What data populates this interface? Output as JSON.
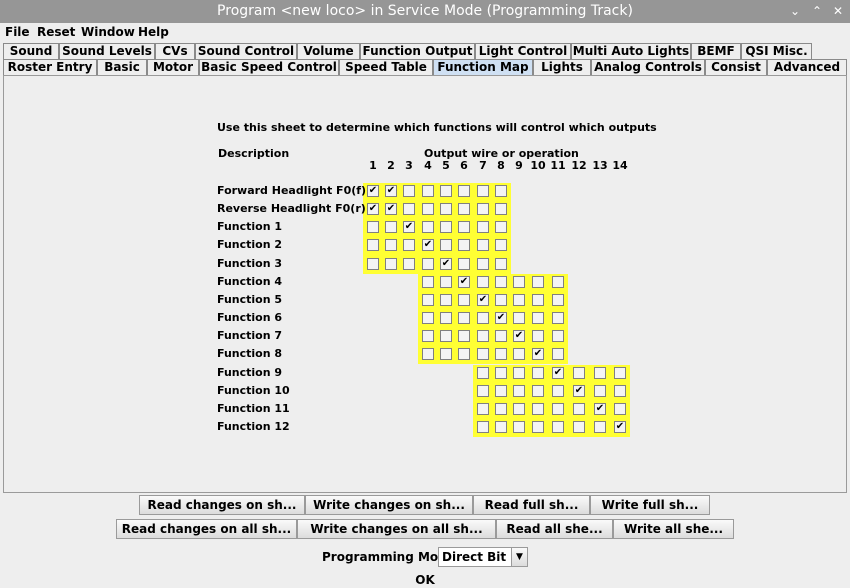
{
  "window": {
    "title": "Program <new loco> in Service Mode (Programming Track)",
    "minimize_glyph": "⌄",
    "maximize_glyph": "⌃",
    "close_glyph": "✕"
  },
  "menu": [
    "File",
    "Reset",
    "Window",
    "Help"
  ],
  "tabs_row1": [
    "Sound",
    "Sound Levels",
    "CVs",
    "Sound Control",
    "Volume",
    "Function Output",
    "Light Control",
    "Multi Auto Lights",
    "BEMF",
    "QSI Misc."
  ],
  "tabs_row2": [
    "Roster Entry",
    "Basic",
    "Motor",
    "Basic Speed Control",
    "Speed Table",
    "Function Map",
    "Lights",
    "Analog Controls",
    "Consist",
    "Advanced"
  ],
  "selected_tab": "Function Map",
  "function_map": {
    "intro": "Use this sheet to determine which functions will control which outputs",
    "description_header": "Description",
    "output_header": "Output wire or operation",
    "outputs": [
      "1",
      "2",
      "3",
      "4",
      "5",
      "6",
      "7",
      "8",
      "9",
      "10",
      "11",
      "12",
      "13",
      "14"
    ],
    "check_glyph": "✔",
    "rows": [
      {
        "label": "Forward Headlight F0(f)",
        "start": 0,
        "end": 7,
        "checked": [
          0,
          1
        ]
      },
      {
        "label": "Reverse Headlight F0(r)",
        "start": 0,
        "end": 7,
        "checked": [
          0,
          1
        ]
      },
      {
        "label": "Function 1",
        "start": 0,
        "end": 7,
        "checked": [
          2
        ]
      },
      {
        "label": "Function 2",
        "start": 0,
        "end": 7,
        "checked": [
          3
        ]
      },
      {
        "label": "Function 3",
        "start": 0,
        "end": 7,
        "checked": [
          4
        ]
      },
      {
        "label": "Function 4",
        "start": 3,
        "end": 10,
        "checked": [
          5
        ]
      },
      {
        "label": "Function 5",
        "start": 3,
        "end": 10,
        "checked": [
          6
        ]
      },
      {
        "label": "Function 6",
        "start": 3,
        "end": 10,
        "checked": [
          7
        ]
      },
      {
        "label": "Function 7",
        "start": 3,
        "end": 10,
        "checked": [
          8
        ]
      },
      {
        "label": "Function 8",
        "start": 3,
        "end": 10,
        "checked": [
          9
        ]
      },
      {
        "label": "Function 9",
        "start": 6,
        "end": 13,
        "checked": [
          10
        ]
      },
      {
        "label": "Function 10",
        "start": 6,
        "end": 13,
        "checked": [
          11
        ]
      },
      {
        "label": "Function 11",
        "start": 6,
        "end": 13,
        "checked": [
          12
        ]
      },
      {
        "label": "Function 12",
        "start": 6,
        "end": 13,
        "checked": [
          13
        ]
      }
    ]
  },
  "buttons_row1": [
    "Read changes on sh...",
    "Write changes on sh...",
    "Read full sh...",
    "Write full sh..."
  ],
  "buttons_row2": [
    "Read changes on all sh...",
    "Write changes on all sh...",
    "Read all she...",
    "Write all she..."
  ],
  "programming_mode": {
    "label": "Programming Mode",
    "value": "Direct Bit",
    "arrow_glyph": "▼"
  },
  "ok_label": "OK"
}
